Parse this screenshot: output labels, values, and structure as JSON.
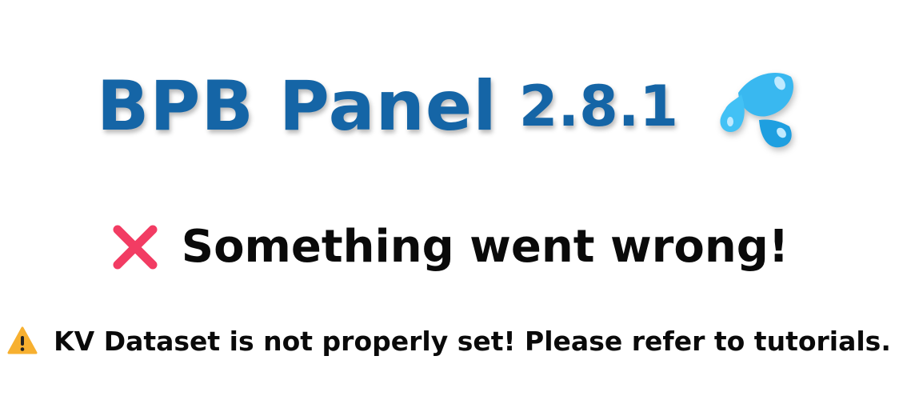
{
  "header": {
    "title": "BPB Panel",
    "version": "2.8.1",
    "icon": "sweat-droplets-icon"
  },
  "error": {
    "icon": "cross-mark-icon",
    "message": "Something went wrong!"
  },
  "warning": {
    "icon": "warning-icon",
    "message": "KV Dataset is not properly set! Please refer to tutorials."
  },
  "colors": {
    "title": "#1565a6",
    "cross": "#f23c63",
    "warning": "#f7b030",
    "droplets": "#39b8f0"
  }
}
